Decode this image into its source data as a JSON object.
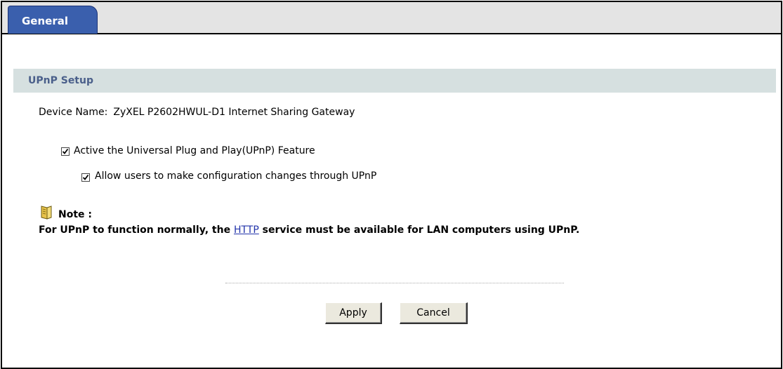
{
  "tabs": [
    {
      "label": "General",
      "active": true
    }
  ],
  "section": {
    "title": "UPnP Setup"
  },
  "device": {
    "label": "Device Name:",
    "value": "ZyXEL P2602HWUL-D1  Internet Sharing Gateway"
  },
  "options": [
    {
      "label": "Active the Universal Plug and Play(UPnP) Feature",
      "checked": true
    },
    {
      "label": "Allow users to make configuration changes through UPnP",
      "checked": true
    }
  ],
  "note": {
    "icon": "note-icon",
    "label": "Note :",
    "text_before": "For UPnP to function normally, the ",
    "link": "HTTP",
    "text_after": " service must be available for LAN computers using UPnP."
  },
  "buttons": {
    "apply": "Apply",
    "cancel": "Cancel"
  },
  "colors": {
    "tab": "#3a5fad",
    "section_bg": "#d6e0e0",
    "section_text": "#4a5f8a",
    "link": "#2233aa"
  }
}
